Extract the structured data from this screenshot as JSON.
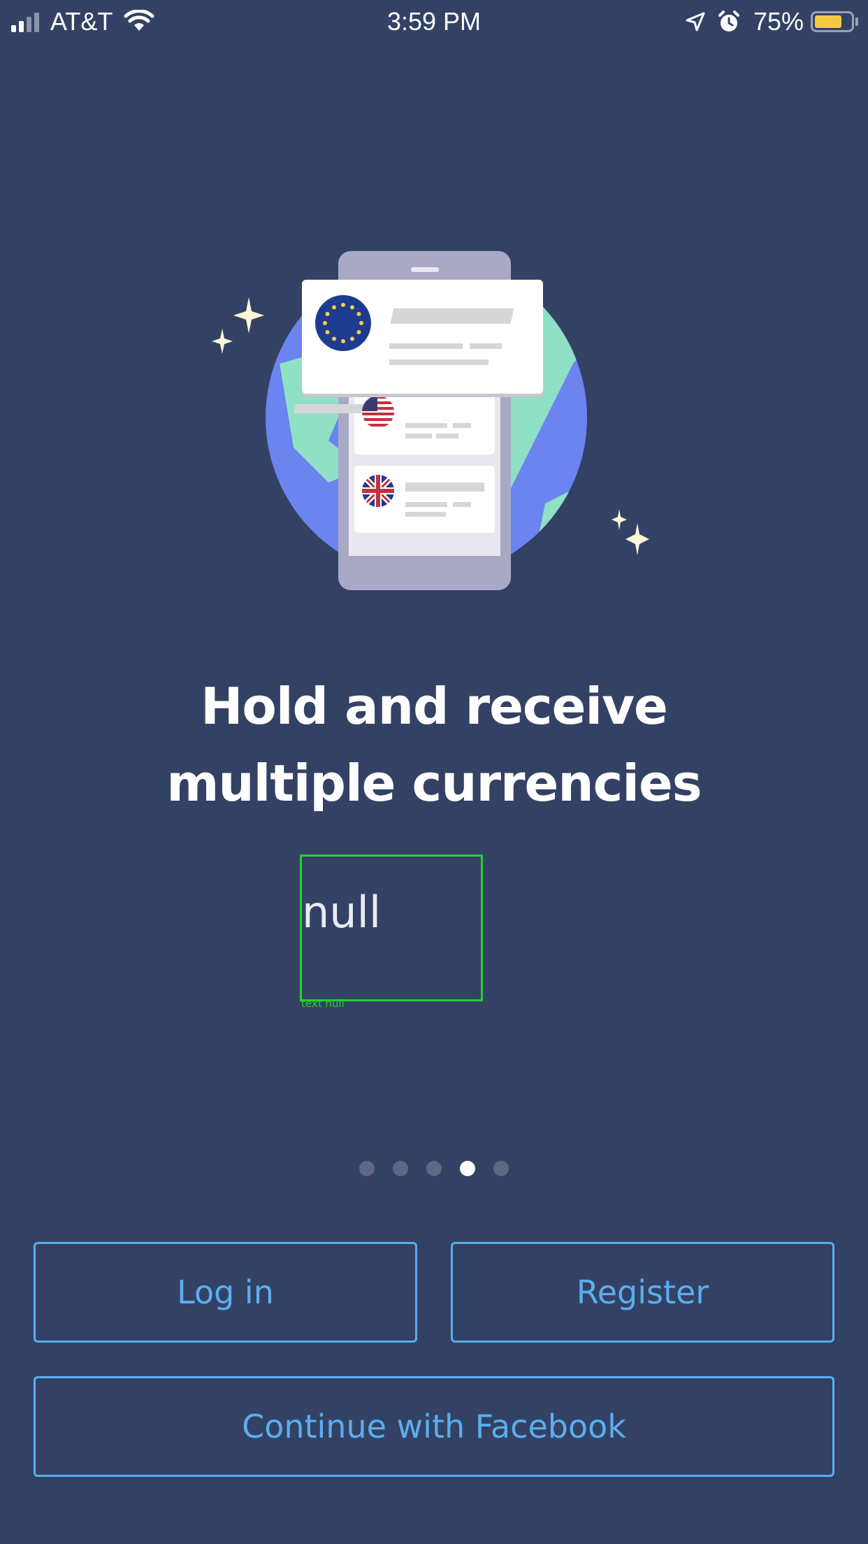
{
  "status_bar": {
    "carrier": "AT&T",
    "time": "3:59 PM",
    "battery_percent": "75%",
    "battery_level": 0.75,
    "battery_color": "#f5c940",
    "icons": [
      "signal-icon",
      "wifi-icon",
      "location-arrow-icon",
      "alarm-icon",
      "battery-icon"
    ]
  },
  "illustration": {
    "description_icons": [
      "globe-icon",
      "phone-icon",
      "eu-flag-icon",
      "us-flag-icon",
      "uk-flag-icon",
      "sparkle-icon"
    ]
  },
  "headline": {
    "line1": "Hold and receive",
    "line2": "multiple currencies"
  },
  "overlay": {
    "text": "null",
    "caption": "text null",
    "color": "#22d12b"
  },
  "pagination": {
    "total": 5,
    "active_index": 3
  },
  "buttons": {
    "login": "Log in",
    "register": "Register",
    "facebook": "Continue with Facebook"
  },
  "colors": {
    "background": "#334264",
    "accent": "#5aaef0"
  }
}
